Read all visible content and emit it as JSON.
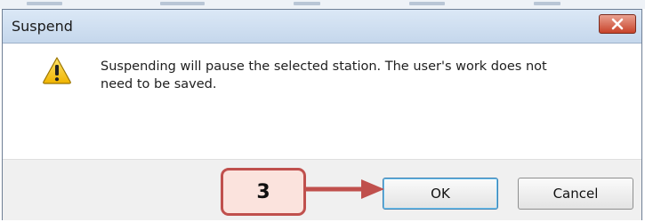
{
  "dialog": {
    "title": "Suspend",
    "message": "Suspending will pause the selected station. The user's work does not need to be saved.",
    "message_line1": "Suspending will pause the selected station. The user's work does not",
    "message_line2": "need to be saved.",
    "icon": "warning-icon",
    "close_icon": "close-icon"
  },
  "buttons": {
    "ok_label": "OK",
    "cancel_label": "Cancel"
  },
  "annotation": {
    "step_number": "3",
    "arrow_target": "ok-button"
  },
  "colors": {
    "titlebar": "#c5d7ec",
    "close_button": "#c8432a",
    "callout_fill": "#fbe3dd",
    "callout_border": "#c0504d",
    "arrow": "#c0504d",
    "footer": "#f0f0f0",
    "warning_yellow": "#f2c200"
  }
}
